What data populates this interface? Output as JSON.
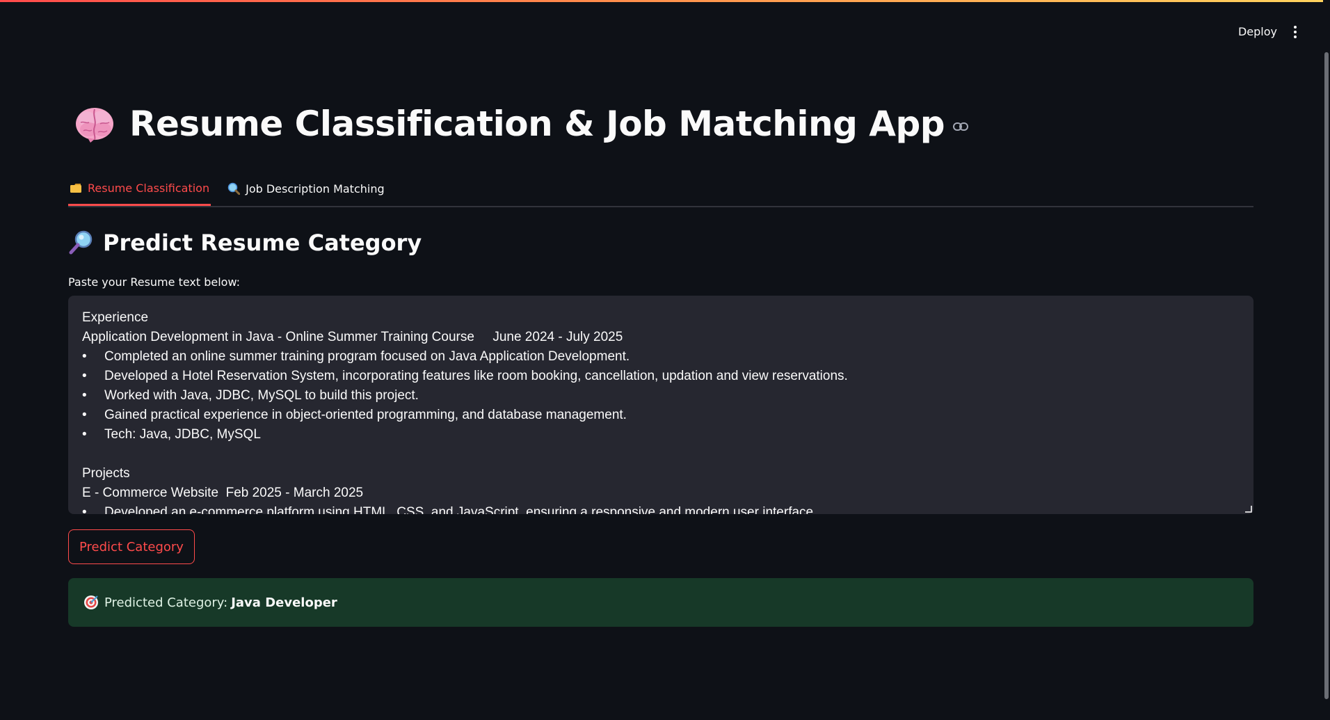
{
  "header": {
    "deploy_label": "Deploy",
    "menu_icon": "vertical-ellipsis-icon"
  },
  "title": {
    "icon": "brain-icon",
    "text": "Resume Classification & Job Matching App",
    "link_icon": "link-icon"
  },
  "tabs": [
    {
      "icon": "folder-icon",
      "label": "Resume Classification",
      "active": true
    },
    {
      "icon": "magnifier-icon",
      "label": "Job Description Matching",
      "active": false
    }
  ],
  "section": {
    "icon": "magnifier-icon",
    "title": "Predict Resume Category"
  },
  "resume_input": {
    "label": "Paste your Resume text below:",
    "lines": [
      {
        "type": "text",
        "text": "Experience"
      },
      {
        "type": "text",
        "text": "Application Development in Java - Online Summer Training Course     June 2024 - July 2025"
      },
      {
        "type": "bullet",
        "text": "Completed an online summer training program focused on Java Application Development."
      },
      {
        "type": "bullet",
        "text": "Developed a Hotel Reservation System, incorporating features like room booking, cancellation, updation and view reservations."
      },
      {
        "type": "bullet",
        "text": "Worked with Java, JDBC, MySQL to build this project."
      },
      {
        "type": "bullet",
        "text": "Gained practical experience in object-oriented programming, and database management."
      },
      {
        "type": "bullet",
        "text": "Tech: Java, JDBC, MySQL"
      },
      {
        "type": "text",
        "text": ""
      },
      {
        "type": "text",
        "text": "Projects"
      },
      {
        "type": "text",
        "text": "E - Commerce Website  Feb 2025 - March 2025"
      },
      {
        "type": "bullet",
        "text": "Developed an e-commerce platform using HTML, CSS, and JavaScript, ensuring a responsive and modern user interface."
      }
    ]
  },
  "predict_button": {
    "label": "Predict Category"
  },
  "result": {
    "icon": "dart-target-icon",
    "prefix": "Predicted Category:",
    "value": "Java Developer"
  },
  "colors": {
    "accent": "#ff4b4b",
    "background": "#0e1117",
    "input_bg": "#262730",
    "success_bg": "#173928"
  }
}
